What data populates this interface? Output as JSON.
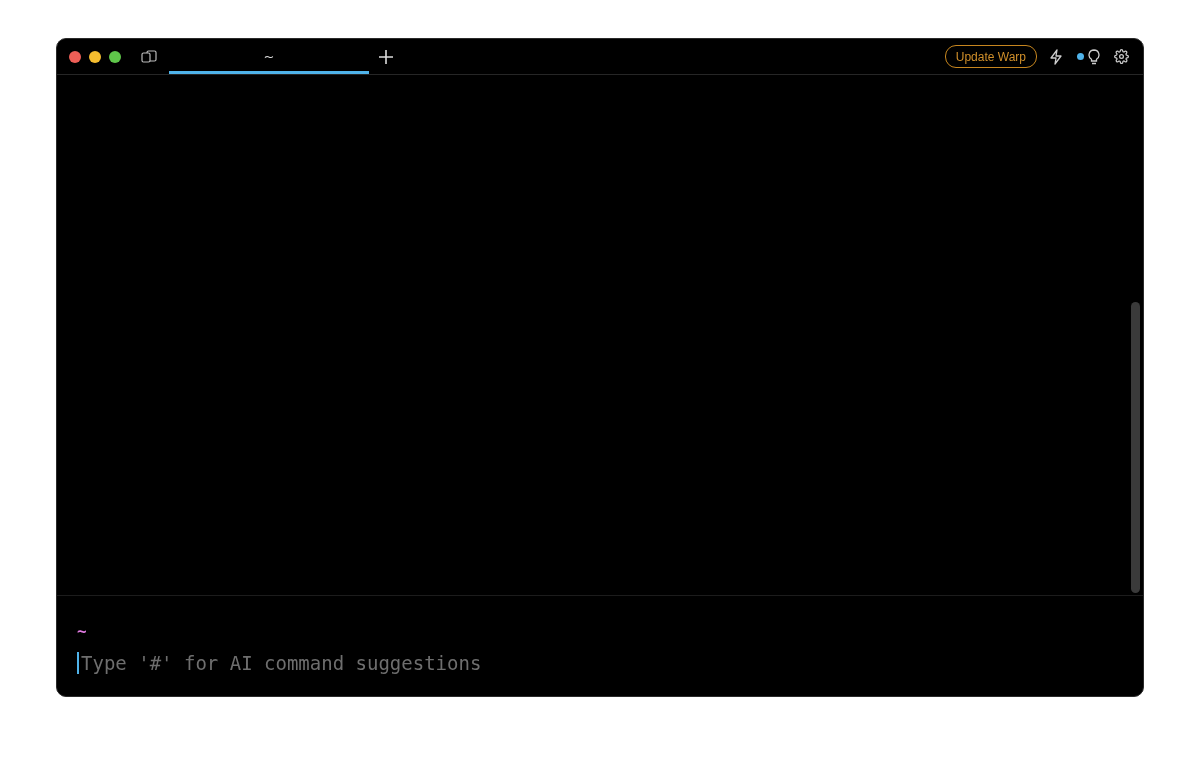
{
  "tabs": [
    {
      "label": "~",
      "selected": true
    }
  ],
  "update_button": {
    "label": "Update Warp"
  },
  "prompt": {
    "directory": "~",
    "placeholder": "Type '#' for AI command suggestions"
  }
}
